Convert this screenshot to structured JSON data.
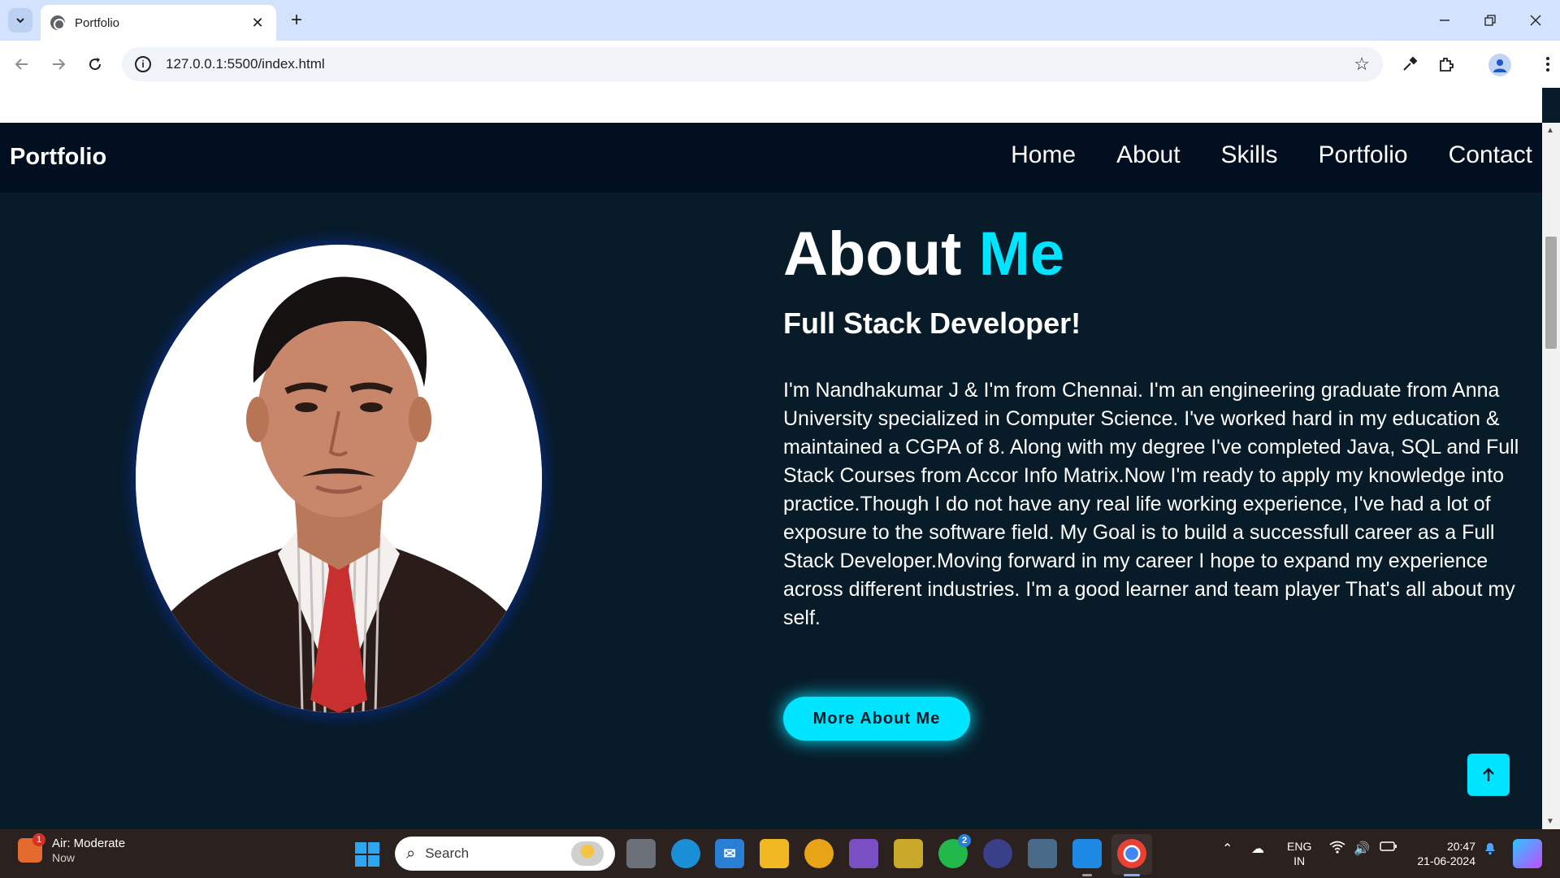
{
  "browser": {
    "tab_title": "Portfolio",
    "tab_close": "✕",
    "new_tab": "+",
    "url": "127.0.0.1:5500/index.html"
  },
  "site": {
    "brand": "Portfolio",
    "nav": [
      "Home",
      "About",
      "Skills",
      "Portfolio",
      "Contact"
    ],
    "heading_main": "About",
    "heading_accent": "Me",
    "subheading": "Full Stack Developer!",
    "paragraph": "I'm Nandhakumar J & I'm from Chennai. I'm an engineering graduate from Anna University specialized in Computer Science. I've worked hard in my education & maintained a CGPA of 8. Along with my degree I've completed Java, SQL and Full Stack Courses from Accor Info Matrix.Now I'm ready to apply my knowledge into practice.Though I do not have any real life working experience, I've had a lot of exposure to the software field. My Goal is to build a successfull career as a Full Stack Developer.Moving forward in my career I hope to expand my experience across different industries. I'm a good learner and team player That's all about my self.",
    "more_button": "More About Me",
    "accent_color": "#00e5ff",
    "background_color": "#081b29"
  },
  "taskbar": {
    "weather_title": "Air: Moderate",
    "weather_sub": "Now",
    "weather_badge": "1",
    "search_placeholder": "Search",
    "whatsapp_badge": "2",
    "lang_line1": "ENG",
    "lang_line2": "IN",
    "time": "20:47",
    "date": "21-06-2024"
  }
}
